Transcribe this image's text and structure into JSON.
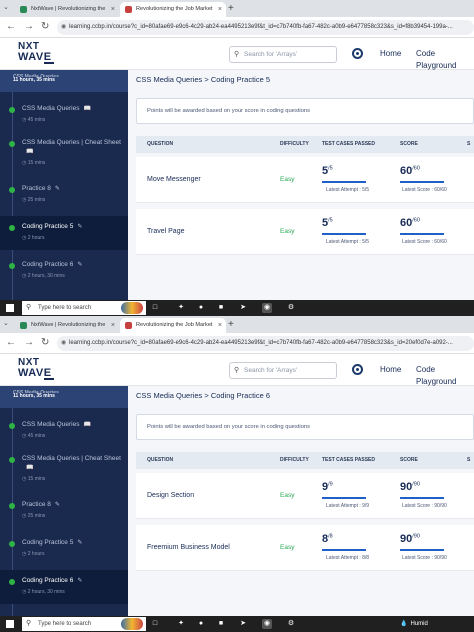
{
  "screens": [
    {
      "tabs": [
        {
          "label": "NxtWave | Revolutionizing the",
          "close": "×"
        },
        {
          "label": "Revolutionizing the Job Market",
          "close": "×"
        }
      ],
      "new_tab": "+",
      "url": "learning.ccbp.in/course?c_id=80afae69-e9c6-4c29-ab24-ea4495213e9f&t_id=c7b740fb-fa67-482c-a0b9-e6477858c323&s_id=f8b39454-199a-...",
      "logo": {
        "line1": "NXT",
        "line2": "WAVE"
      },
      "search_placeholder": "Search for 'Arrays'",
      "nav": {
        "home": "Home",
        "code_playground": "Code Playground"
      },
      "sidebar_top": {
        "clipped": "CSS Media Queries",
        "duration": "11 hours, 35 mins"
      },
      "sidebar": [
        {
          "title": "CSS Media Queries",
          "meta": "45 mins",
          "icon": "book-icon"
        },
        {
          "title": "CSS Media Queries | Cheat Sheet",
          "meta": "15 mins",
          "icon": "book-icon"
        },
        {
          "title": "Practice 8",
          "meta": "25 mins",
          "icon": "pencil-icon"
        },
        {
          "title": "Coding Practice 5",
          "meta": "2 hours",
          "icon": "pencil-icon",
          "active": true
        },
        {
          "title": "Coding Practice 6",
          "meta": "2 hours, 30 mins",
          "icon": "pencil-icon"
        }
      ],
      "breadcrumb": "CSS Media Queries > Coding Practice 5",
      "notice": "Points will be awarded based on your score in coding questions",
      "columns": {
        "question": "QUESTION",
        "difficulty": "DIFFICULTY",
        "tests": "TEST CASES PASSED",
        "score": "SCORE",
        "edge": "S"
      },
      "rows": [
        {
          "question": "Move Messenger",
          "difficulty": "Easy",
          "passed": "5",
          "total": "/5",
          "attempt": "Latest Attempt : 5/5",
          "score": "60",
          "max": "/60",
          "latest_score": "Latest Score : 60/60"
        },
        {
          "question": "Travel Page",
          "difficulty": "Easy",
          "passed": "5",
          "total": "/5",
          "attempt": "Latest Attempt : 5/5",
          "score": "60",
          "max": "/60",
          "latest_score": "Latest Score : 60/60"
        }
      ],
      "taskbar": {
        "search": "Type here to search",
        "weather": ""
      }
    },
    {
      "tabs": [
        {
          "label": "NxtWave | Revolutionizing the",
          "close": "×"
        },
        {
          "label": "Revolutionizing the Job Market",
          "close": "×"
        }
      ],
      "new_tab": "+",
      "url": "learning.ccbp.in/course?c_id=80afae69-e9c6-4c29-ab24-ea4495213e9f&t_id=c7b740fb-fa67-482c-a0b9-e6477858c323&s_id=20ef0d7e-a092-...",
      "logo": {
        "line1": "NXT",
        "line2": "WAVE"
      },
      "search_placeholder": "Search for 'Arrays'",
      "nav": {
        "home": "Home",
        "code_playground": "Code Playground"
      },
      "sidebar_top": {
        "clipped": "CSS Media Queries",
        "duration": "11 hours, 35 mins"
      },
      "sidebar": [
        {
          "title": "CSS Media Queries",
          "meta": "45 mins",
          "icon": "book-icon"
        },
        {
          "title": "CSS Media Queries | Cheat Sheet",
          "meta": "15 mins",
          "icon": "book-icon"
        },
        {
          "title": "Practice 8",
          "meta": "25 mins",
          "icon": "pencil-icon"
        },
        {
          "title": "Coding Practice 5",
          "meta": "2 hours",
          "icon": "pencil-icon"
        },
        {
          "title": "Coding Practice 6",
          "meta": "2 hours, 30 mins",
          "icon": "pencil-icon",
          "active": true
        }
      ],
      "breadcrumb": "CSS Media Queries > Coding Practice 6",
      "notice": "Points will be awarded based on your score in coding questions",
      "columns": {
        "question": "QUESTION",
        "difficulty": "DIFFICULTY",
        "tests": "TEST CASES PASSED",
        "score": "SCORE",
        "edge": "S"
      },
      "rows": [
        {
          "question": "Design Section",
          "difficulty": "Easy",
          "passed": "9",
          "total": "/9",
          "attempt": "Latest Attempt : 9/9",
          "score": "90",
          "max": "/90",
          "latest_score": "Latest Score : 90/90"
        },
        {
          "question": "Freemium Business Model",
          "difficulty": "Easy",
          "passed": "8",
          "total": "/8",
          "attempt": "Latest Attempt : 8/8",
          "score": "90",
          "max": "/90",
          "latest_score": "Latest Score : 90/90"
        }
      ],
      "taskbar": {
        "search": "Type here to search",
        "weather": "Humid"
      }
    }
  ],
  "colors": {
    "sidebar": "#1a2a4f",
    "active_item": "#0e1d3b",
    "easy": "#2aa956",
    "progress": "#1f61c9",
    "brand": "#172b56"
  }
}
